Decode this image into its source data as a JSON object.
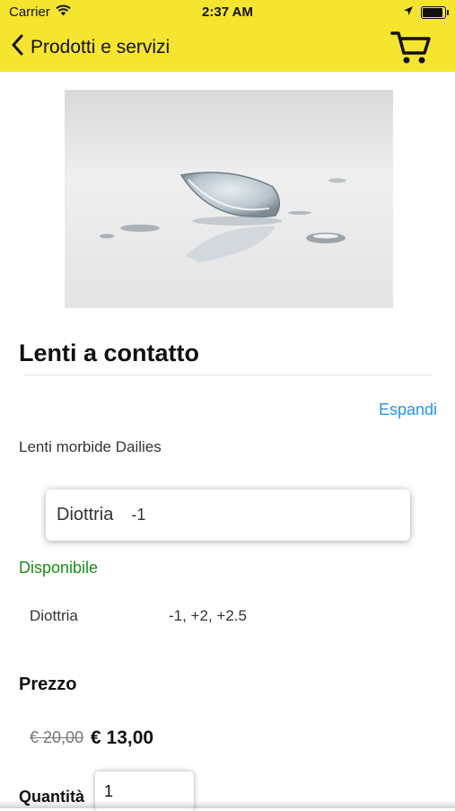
{
  "status_bar": {
    "carrier": "Carrier",
    "time": "2:37 AM"
  },
  "nav": {
    "back_label": "Prodotti e servizi",
    "cart_icon": "shopping-cart-icon",
    "background_color": "#f5e52e"
  },
  "product": {
    "image_subject": "contact-lens-photo",
    "title": "Lenti a contatto",
    "expand_label": "Espandi",
    "subtitle": "Lenti morbide Dailies",
    "option": {
      "label": "Diottria",
      "value": "-1"
    },
    "availability": "Disponibile",
    "availability_color": "#1a8d1a",
    "spec": {
      "label": "Diottria",
      "value": "-1, +2, +2.5"
    },
    "price_heading": "Prezzo",
    "old_price": "€ 20,00",
    "new_price": "€ 13,00",
    "quantity_label": "Quantità",
    "quantity_value": "1"
  },
  "colors": {
    "link": "#2196f3"
  }
}
